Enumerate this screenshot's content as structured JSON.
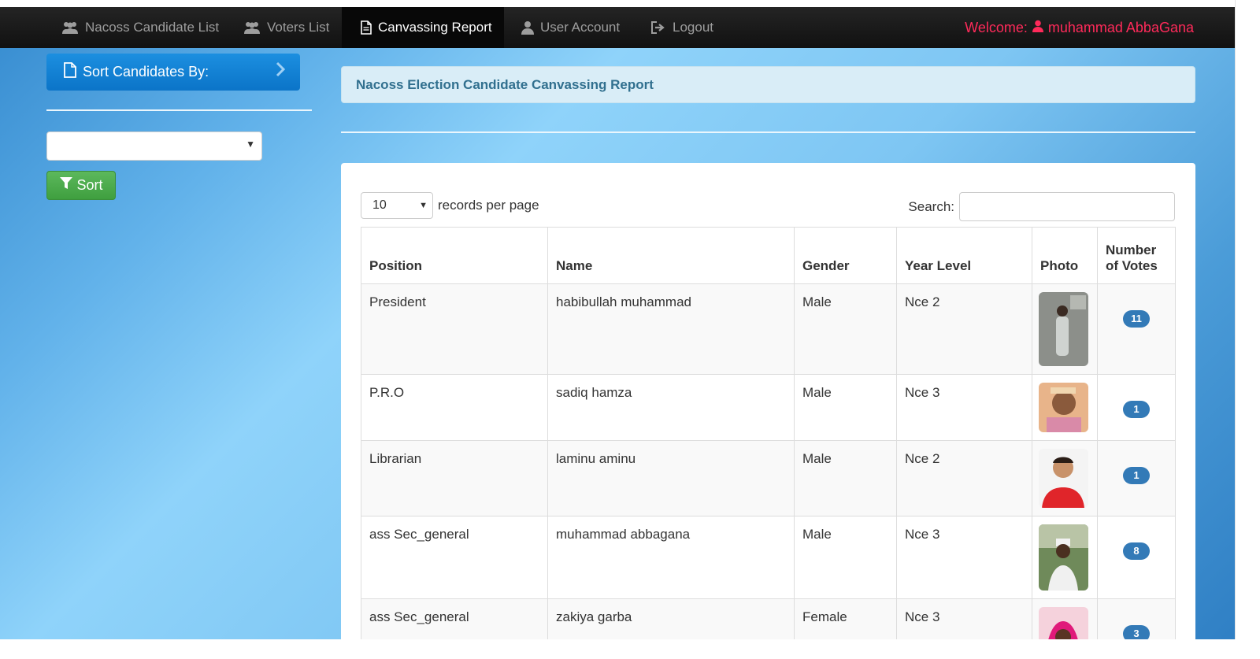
{
  "nav": {
    "items": [
      {
        "label": "Nacoss Candidate List",
        "icon": "users-icon"
      },
      {
        "label": "Voters List",
        "icon": "users-icon"
      },
      {
        "label": "Canvassing Report",
        "icon": "file-icon",
        "active": true
      },
      {
        "label": "User Account",
        "icon": "user-icon"
      },
      {
        "label": "Logout",
        "icon": "logout-icon"
      }
    ],
    "welcome_prefix": "Welcome:",
    "username": "muhammad AbbaGana"
  },
  "sidebar": {
    "heading": "Sort Candidates By:",
    "select_value": "",
    "sort_button": "Sort"
  },
  "report": {
    "title": "Nacoss Election Candidate Canvassing Report",
    "records_per_page_value": "10",
    "records_per_page_label": "records per page",
    "search_label": "Search:",
    "search_value": "",
    "columns": [
      "Position",
      "Name",
      "Gender",
      "Year Level",
      "Photo",
      "Number of Votes"
    ],
    "rows": [
      {
        "position": "President",
        "name": "habibullah muhammad",
        "gender": "Male",
        "year": "Nce 2",
        "votes": "11"
      },
      {
        "position": "P.R.O",
        "name": "sadiq hamza",
        "gender": "Male",
        "year": "Nce 3",
        "votes": "1"
      },
      {
        "position": "Librarian",
        "name": "laminu aminu",
        "gender": "Male",
        "year": "Nce 2",
        "votes": "1"
      },
      {
        "position": "ass Sec_general",
        "name": "muhammad abbagana",
        "gender": "Male",
        "year": "Nce 3",
        "votes": "8"
      },
      {
        "position": "ass Sec_general",
        "name": "zakiya garba",
        "gender": "Female",
        "year": "Nce 3",
        "votes": "3"
      }
    ]
  },
  "colors": {
    "navbar": "#1a1a1a",
    "welcome": "#ff2a5a",
    "sidebar_head": "#0f7fd2",
    "sort_button": "#4cae4c",
    "panel_bg": "#d9edf7",
    "panel_text": "#31708f",
    "badge": "#337ab7"
  }
}
